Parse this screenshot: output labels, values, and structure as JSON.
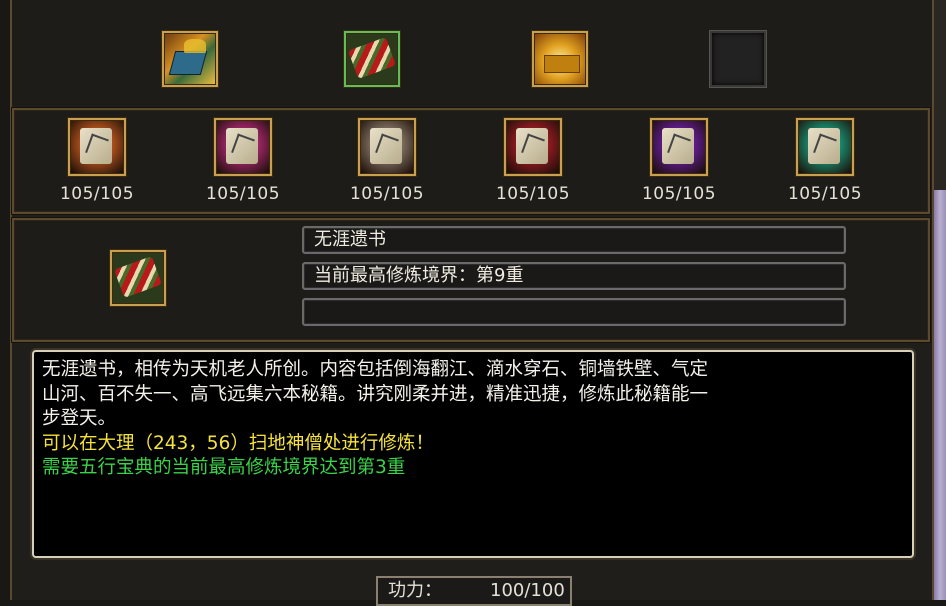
{
  "top_icons": [
    {
      "name": "book-gold-icon",
      "empty": false
    },
    {
      "name": "bundle-scroll-icon",
      "empty": false
    },
    {
      "name": "gold-treasure-icon",
      "empty": false
    },
    {
      "name": "empty-slot-icon",
      "empty": true
    }
  ],
  "scrolls": [
    {
      "icon": "orange-scroll-icon",
      "count": "105/105",
      "color": "#c25a1e"
    },
    {
      "icon": "pink-scroll-icon",
      "count": "105/105",
      "color": "#b02a74"
    },
    {
      "icon": "grey-scroll-icon",
      "count": "105/105",
      "color": "#8a7a6a"
    },
    {
      "icon": "red-scroll-icon",
      "count": "105/105",
      "color": "#a11d24"
    },
    {
      "icon": "purple-scroll-icon",
      "count": "105/105",
      "color": "#6a1fa0"
    },
    {
      "icon": "teal-scroll-icon",
      "count": "105/105",
      "color": "#1a9a7a"
    }
  ],
  "selected": {
    "icon": "bundle-scroll-icon",
    "name": "无涯遗书",
    "realm": "当前最高修炼境界：第9重",
    "extra": ""
  },
  "description": {
    "lines": [
      "无涯遗书，相传为天机老人所创。内容包括倒海翻江、滴水穿石、铜墙铁壁、气定",
      "山河、百不失一、高飞远集六本秘籍。讲究刚柔并进，精准迅捷，修炼此秘籍能一",
      "步登天。"
    ],
    "location": "可以在大理（243，56）扫地神僧处进行修炼！",
    "requirement": "需要五行宝典的当前最高修炼境界达到第3重"
  },
  "power": {
    "label": "功力：",
    "value": "100/100"
  }
}
